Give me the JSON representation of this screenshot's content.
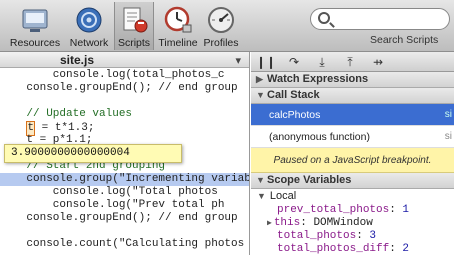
{
  "toolbar": {
    "tabs": [
      {
        "label": "Resources",
        "icon": "resources-icon"
      },
      {
        "label": "Network",
        "icon": "network-icon"
      },
      {
        "label": "Scripts",
        "icon": "scripts-icon",
        "active": true
      },
      {
        "label": "Timeline",
        "icon": "timeline-icon"
      },
      {
        "label": "Profiles",
        "icon": "profiles-icon"
      }
    ],
    "search_label": "Search Scripts",
    "search_value": ""
  },
  "source": {
    "filename": "site.js",
    "lines": [
      "        console.log(total_photos_c",
      "    console.groupEnd(); // end group",
      "",
      "    // Update values",
      "    t = t*1.3;",
      "    t = p*1.1;",
      "",
      "    // Start 2nd grouping",
      "    console.group(\"Incrementing variab",
      "        console.log(\"Total photos",
      "        console.log(\"Prev total ph",
      "    console.groupEnd(); // end group",
      "",
      "    console.count(\"Calculating photos"
    ],
    "hover_value": "3.9000000000000004"
  },
  "debugger": {
    "buttons": [
      "pause-resume",
      "step-over",
      "step-into",
      "step-out",
      "deactivate-breakpoints"
    ],
    "watch_title": "Watch Expressions",
    "callstack_title": "Call Stack",
    "frames": [
      {
        "name": "calcPhotos",
        "file": "si"
      },
      {
        "name": "(anonymous function)",
        "file": "si"
      }
    ],
    "paused_message": "Paused on a JavaScript breakpoint.",
    "scope_title": "Scope Variables",
    "scope_local": "Local",
    "scope_props": [
      {
        "key": "prev_total_photos",
        "value": "1"
      },
      {
        "key": "this",
        "value": "DOMWindow",
        "expandable": true
      },
      {
        "key": "total_photos",
        "value": "3"
      },
      {
        "key": "total_photos_diff",
        "value": "2"
      }
    ]
  },
  "colors": {
    "selection": "#3b6dd1",
    "highlight_line": "#b6caf0",
    "comment": "#236e25",
    "string": "#1a1aa6",
    "tooltip_bg": "#fffbb4",
    "paused_bg": "#fff4a8"
  }
}
